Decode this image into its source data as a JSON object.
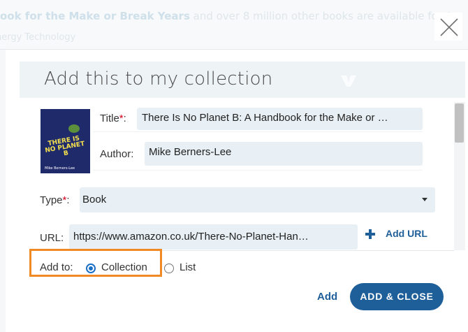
{
  "background": {
    "banner_title": "ook for the Make or Break Years",
    "banner_rest": " and over 8 million other books are available for Am",
    "banner_sub": "nergy Technology"
  },
  "dialog": {
    "title": "Add this to my collection",
    "logo_text": "",
    "fields": {
      "title_label": "Title",
      "title_value": "There Is No Planet B: A Handbook for the Make or …",
      "author_label": "Author:",
      "author_value": "Mike Berners-Lee",
      "type_label": "Type",
      "type_value": "Book",
      "url_label": "URL:",
      "url_value": "https://www.amazon.co.uk/There-No-Planet-Han…",
      "required_mark": "*",
      "colon": ":"
    },
    "add_url_label": "Add URL",
    "add_to": {
      "label": "Add to:",
      "options": [
        "Collection",
        "List"
      ],
      "selected": "Collection"
    },
    "buttons": {
      "add": "Add",
      "add_close": "ADD & CLOSE"
    }
  },
  "cover": {
    "top_text": "",
    "big_text": "THERE IS NO PLANET B",
    "author_text": "Mike Berners-Lee"
  },
  "colors": {
    "accent": "#1e5f99",
    "highlight": "#f08a24",
    "field_bg": "#e8f0f5",
    "required": "#d0021b"
  },
  "icons": [
    "close-icon",
    "chevron-down-icon",
    "plus-icon"
  ]
}
